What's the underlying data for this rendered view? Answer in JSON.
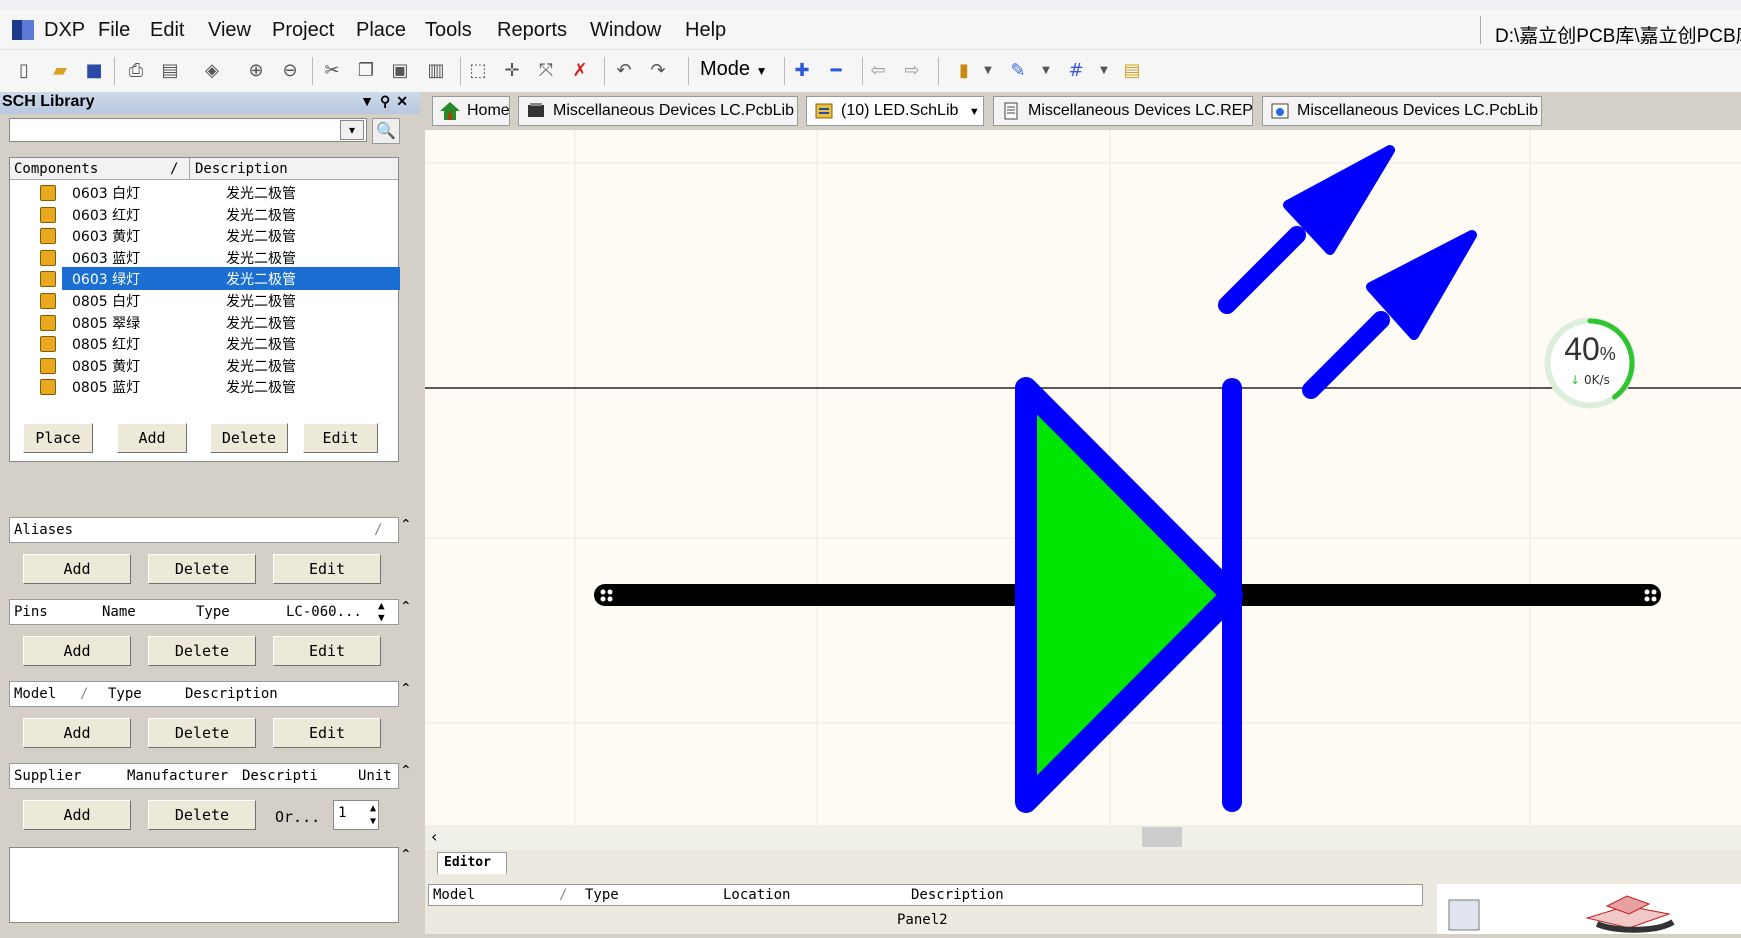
{
  "app": {
    "logo_label": "DXP"
  },
  "menu": [
    "DXP",
    "File",
    "Edit",
    "View",
    "Project",
    "Place",
    "Tools",
    "Reports",
    "Window",
    "Help"
  ],
  "path": "D:\\嘉立创PCB库\\嘉立创PCB库",
  "toolbar": {
    "mode_label": "Mode"
  },
  "panel": {
    "title": "SCH Library",
    "search_value": "",
    "components_header": "Components",
    "description_header": "Description",
    "sort_indicator": "/",
    "components": [
      {
        "name": "0603 白灯",
        "desc": "发光二极管"
      },
      {
        "name": "0603 红灯",
        "desc": "发光二极管"
      },
      {
        "name": "0603 黄灯",
        "desc": "发光二极管"
      },
      {
        "name": "0603 蓝灯",
        "desc": "发光二极管"
      },
      {
        "name": "0603 绿灯",
        "desc": "发光二极管"
      },
      {
        "name": "0805 白灯",
        "desc": "发光二极管"
      },
      {
        "name": "0805 翠绿",
        "desc": "发光二极管"
      },
      {
        "name": "0805 红灯",
        "desc": "发光二极管"
      },
      {
        "name": "0805 黄灯",
        "desc": "发光二极管"
      },
      {
        "name": "0805 蓝灯",
        "desc": "发光二极管"
      }
    ],
    "selected_index": 4,
    "buttons": {
      "place": "Place",
      "add": "Add",
      "delete": "Delete",
      "edit": "Edit"
    },
    "aliases_header": "Aliases",
    "pins_headers": {
      "pins": "Pins",
      "name": "Name",
      "type": "Type",
      "lc": "LC-060..."
    },
    "model_headers": {
      "model": "Model",
      "type": "Type",
      "description": "Description"
    },
    "supplier_headers": {
      "supplier": "Supplier",
      "manufacturer": "Manufacturer",
      "description": "Descripti",
      "unit": "Unit"
    },
    "order_label": "Or...",
    "order_qty": "1"
  },
  "tabs": [
    {
      "label": "Home"
    },
    {
      "label": "Miscellaneous Devices LC.PcbLib"
    },
    {
      "label": "(10) LED.SchLib"
    },
    {
      "label": "Miscellaneous Devices LC.REP"
    },
    {
      "label": "Miscellaneous Devices LC.PcbLib"
    }
  ],
  "gauge": {
    "percent": "40",
    "percent_sign": "%",
    "speed": "0K/s",
    "fraction": 0.4
  },
  "editor": {
    "tab_label": "Editor",
    "columns": {
      "model": "Model",
      "type": "Type",
      "location": "Location",
      "description": "Description"
    },
    "panel_label": "Panel2"
  },
  "colors": {
    "led_fill": "#00e600",
    "led_stroke": "#0000ff",
    "wire": "#000000",
    "selection": "#1c6fd2"
  }
}
